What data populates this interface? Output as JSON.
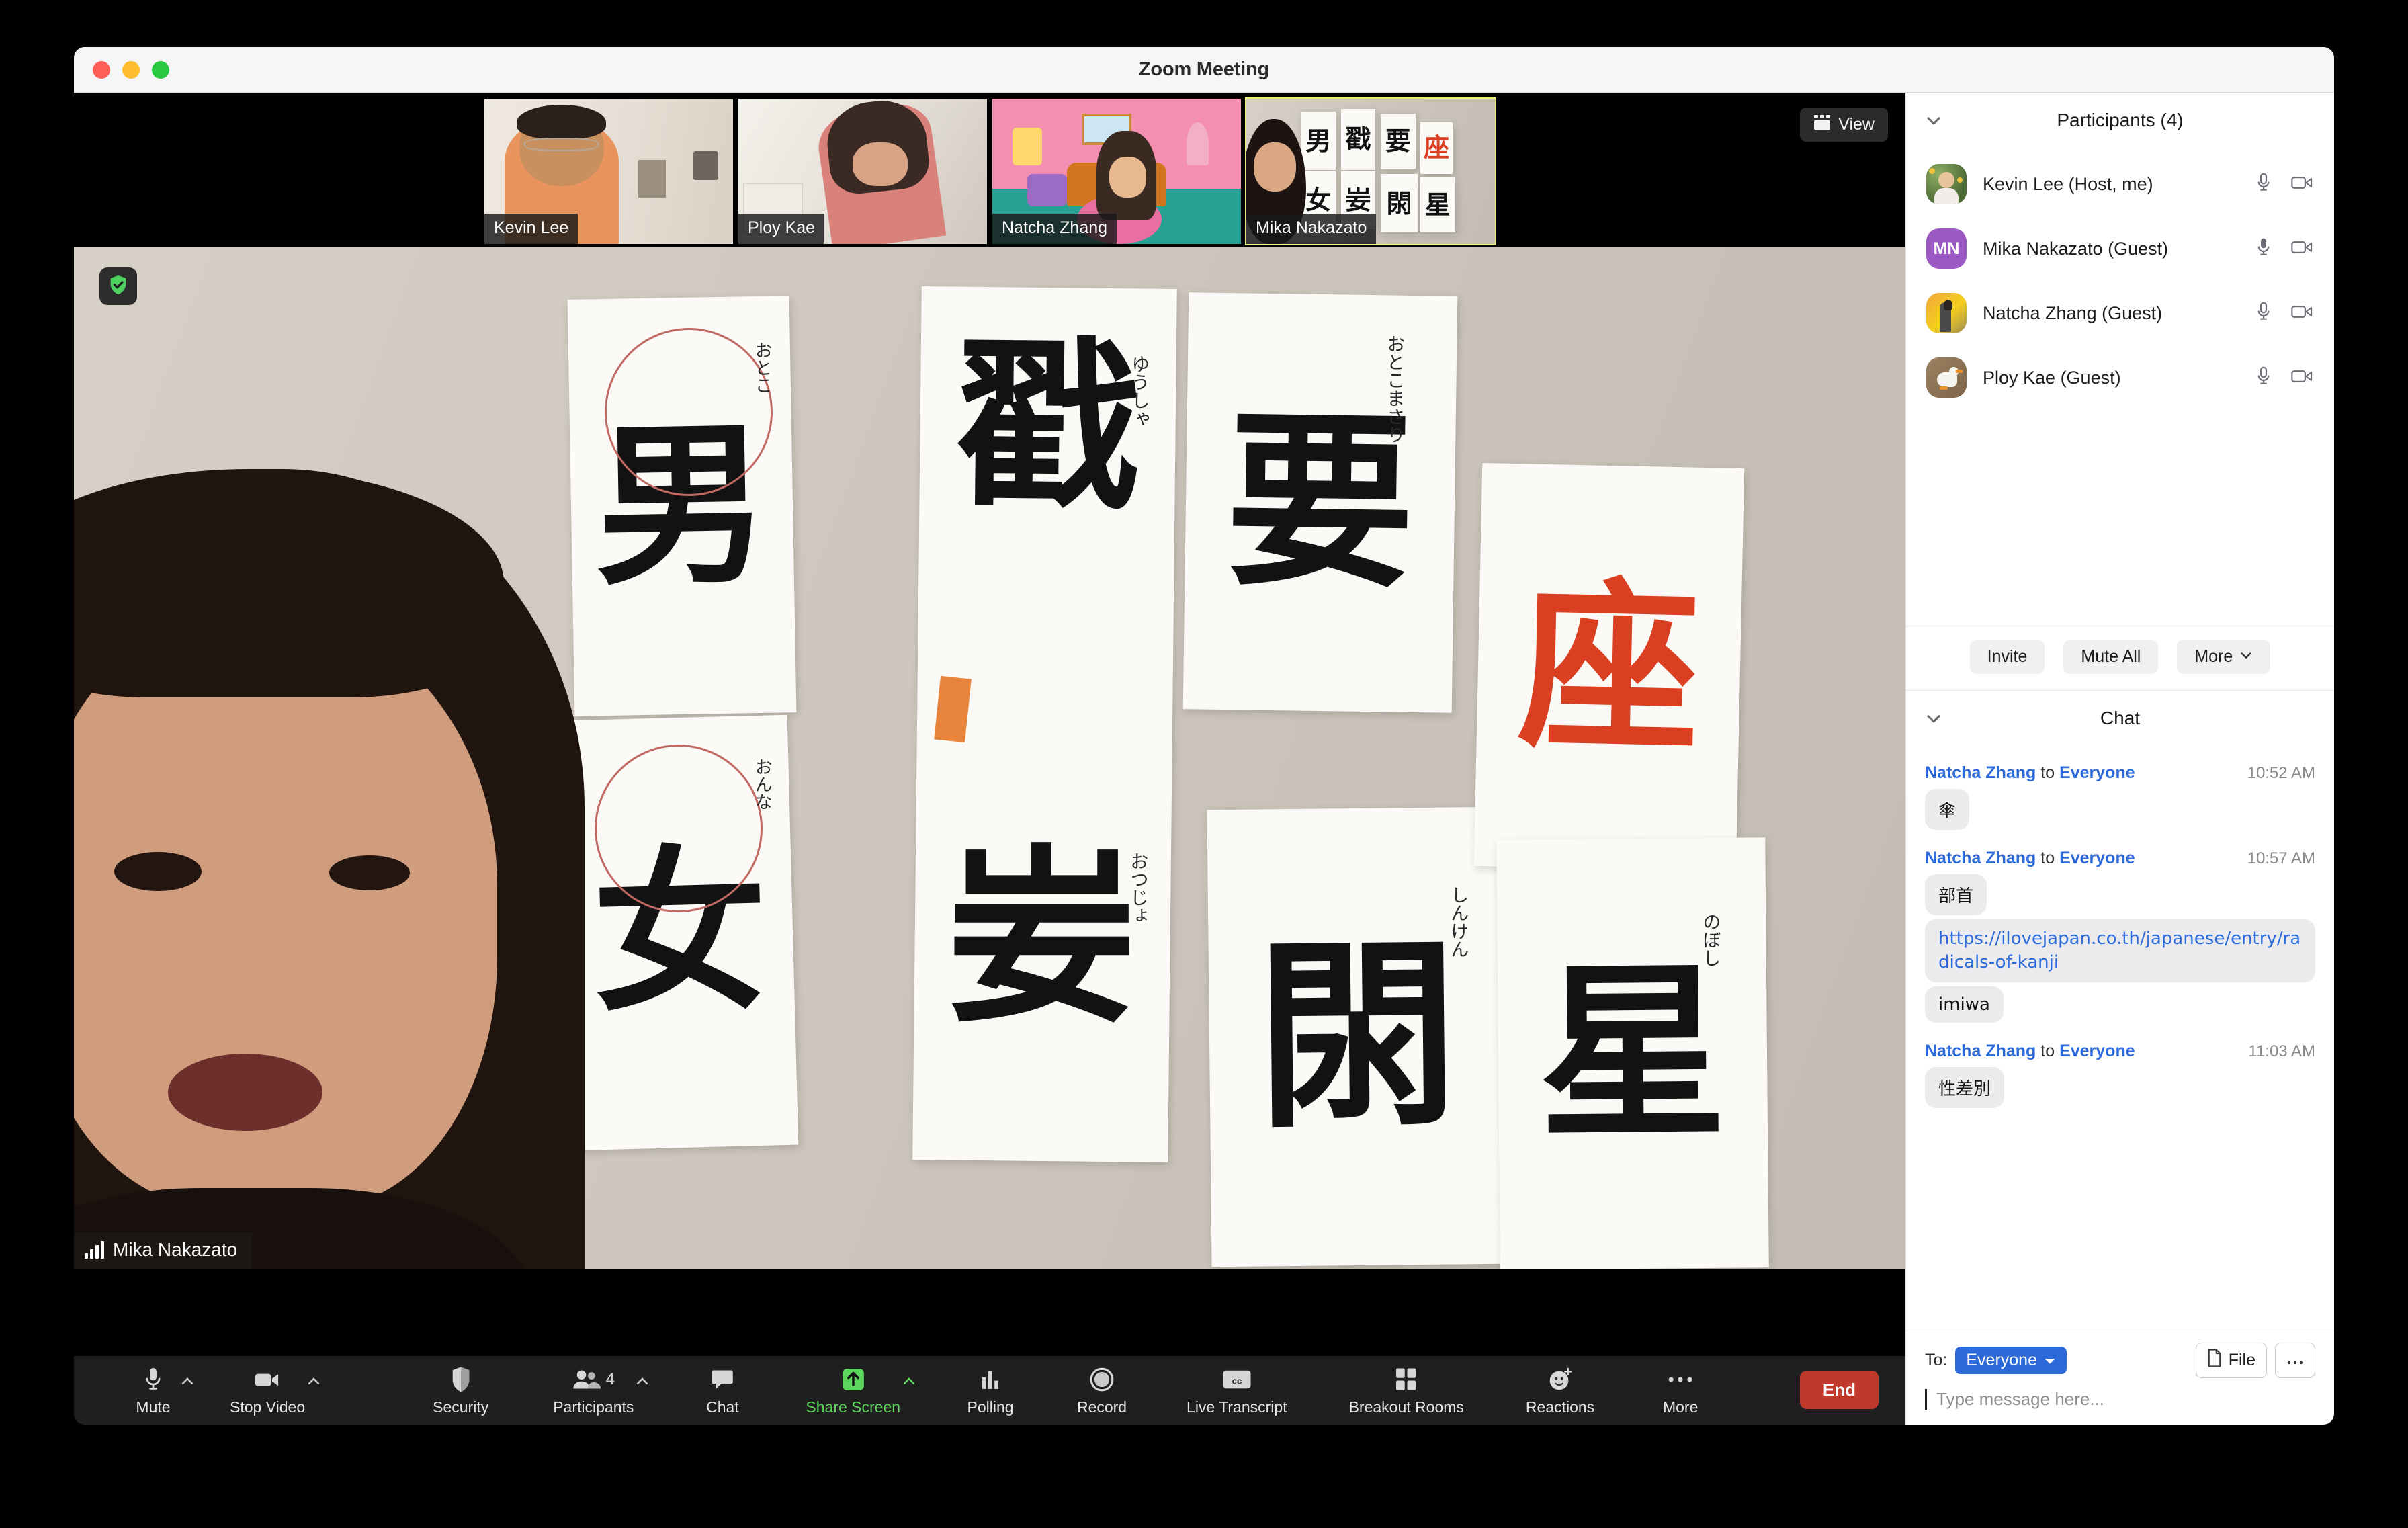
{
  "window": {
    "title": "Zoom Meeting",
    "traffic_lights": [
      "close-red",
      "minimize-yellow",
      "maximize-green"
    ]
  },
  "meeting": {
    "view_button_label": "View",
    "view_icon": "grid-view-icon",
    "encryption_icon": "shield-check-icon",
    "active_speaker": {
      "name": "Mika Nakazato",
      "audio_icon": "audio-level-bars-icon"
    },
    "thumbnails": [
      {
        "name": "Kevin Lee",
        "active": false,
        "scene": "man-glasses-room"
      },
      {
        "name": "Ploy Kae",
        "active": false,
        "scene": "woman-bright-window"
      },
      {
        "name": "Natcha Zhang",
        "active": false,
        "scene": "woman-pink-cartoon-bg"
      },
      {
        "name": "Mika Nakazato",
        "active": true,
        "scene": "woman-calligraphy-wall"
      }
    ],
    "calligraphy": {
      "sheets": [
        {
          "kanji": "男",
          "furigana": "おとこ",
          "circled": true,
          "red": false
        },
        {
          "kanji": "女",
          "furigana": "おんな",
          "circled": true,
          "red": false
        },
        {
          "kanji": "戳",
          "furigana": "ゆうしゃ",
          "circled": false,
          "red": false
        },
        {
          "kanji": "妛",
          "furigana": "おつじょ",
          "circled": false,
          "red": false
        },
        {
          "kanji": "要",
          "furigana": "おとこまさり",
          "circled": false,
          "red": false
        },
        {
          "kanji": "閖",
          "furigana": "しんけん",
          "circled": false,
          "red": false
        },
        {
          "kanji": "座",
          "furigana": "",
          "circled": false,
          "red": true
        },
        {
          "kanji": "星",
          "furigana": "のぼし",
          "circled": false,
          "red": false
        }
      ]
    }
  },
  "toolbar": {
    "items": [
      {
        "label": "Mute",
        "icon": "microphone-icon",
        "caret": true,
        "badge": "",
        "accent": ""
      },
      {
        "label": "Stop Video",
        "icon": "video-camera-icon",
        "caret": true,
        "badge": "",
        "accent": ""
      },
      {
        "label": "Security",
        "icon": "shield-icon",
        "caret": false,
        "badge": "",
        "accent": ""
      },
      {
        "label": "Participants",
        "icon": "people-icon",
        "caret": true,
        "badge": "4",
        "accent": ""
      },
      {
        "label": "Chat",
        "icon": "chat-bubble-icon",
        "caret": false,
        "badge": "",
        "accent": ""
      },
      {
        "label": "Share Screen",
        "icon": "share-screen-icon",
        "caret": true,
        "badge": "",
        "accent": "#5cd65c"
      },
      {
        "label": "Polling",
        "icon": "poll-bars-icon",
        "caret": false,
        "badge": "",
        "accent": ""
      },
      {
        "label": "Record",
        "icon": "record-circle-icon",
        "caret": false,
        "badge": "",
        "accent": ""
      },
      {
        "label": "Live Transcript",
        "icon": "closed-caption-icon",
        "caret": false,
        "badge": "",
        "accent": ""
      },
      {
        "label": "Breakout Rooms",
        "icon": "breakout-grid-icon",
        "caret": false,
        "badge": "",
        "accent": ""
      },
      {
        "label": "Reactions",
        "icon": "smiley-plus-icon",
        "caret": false,
        "badge": "",
        "accent": ""
      },
      {
        "label": "More",
        "icon": "ellipsis-icon",
        "caret": false,
        "badge": "",
        "accent": ""
      }
    ],
    "end_label": "End",
    "end_color": "#c0392b"
  },
  "sidebar": {
    "participants_panel": {
      "title": "Participants (4)",
      "collapse_icon": "chevron-down-icon",
      "rows": [
        {
          "name": "Kevin Lee (Host, me)",
          "avatar_type": "photo",
          "avatar_text": "",
          "avatar_color": "#6f8f5a",
          "mic_icon": "microphone-icon",
          "mic_muted": false,
          "video_icon": "video-camera-icon"
        },
        {
          "name": "Mika Nakazato (Guest)",
          "avatar_type": "initials",
          "avatar_text": "MN",
          "avatar_color": "#9b59c4",
          "mic_icon": "microphone-icon",
          "mic_muted": true,
          "video_icon": "video-camera-icon"
        },
        {
          "name": "Natcha Zhang (Guest)",
          "avatar_type": "photo",
          "avatar_text": "",
          "avatar_color": "#f2c014",
          "mic_icon": "microphone-icon",
          "mic_muted": false,
          "video_icon": "video-camera-icon"
        },
        {
          "name": "Ploy Kae (Guest)",
          "avatar_type": "photo",
          "avatar_text": "",
          "avatar_color": "#8a7254",
          "mic_icon": "microphone-icon",
          "mic_muted": false,
          "video_icon": "video-camera-icon"
        }
      ],
      "actions": [
        {
          "label": "Invite",
          "caret": false
        },
        {
          "label": "Mute All",
          "caret": false
        },
        {
          "label": "More",
          "caret": true
        }
      ]
    },
    "chat_panel": {
      "title": "Chat",
      "collapse_icon": "chevron-down-icon",
      "messages": [
        {
          "sender": "Natcha Zhang",
          "to_word": "to",
          "recipient": "Everyone",
          "time": "10:52 AM",
          "bubbles": [
            {
              "text": "傘",
              "is_link": false
            }
          ]
        },
        {
          "sender": "Natcha Zhang",
          "to_word": "to",
          "recipient": "Everyone",
          "time": "10:57 AM",
          "bubbles": [
            {
              "text": "部首",
              "is_link": false
            },
            {
              "text": "https://ilovejapan.co.th/japanese/entry/radicals-of-kanji",
              "is_link": true
            },
            {
              "text": "imiwa",
              "is_link": false
            }
          ]
        },
        {
          "sender": "Natcha Zhang",
          "to_word": "to",
          "recipient": "Everyone",
          "time": "11:03 AM",
          "bubbles": [
            {
              "text": "性差別",
              "is_link": false
            }
          ]
        }
      ],
      "compose": {
        "to_label": "To:",
        "recipient": "Everyone",
        "recipient_caret_icon": "caret-down-icon",
        "file_label": "File",
        "file_icon": "document-icon",
        "more_icon": "ellipsis-icon",
        "placeholder": "Type message here..."
      }
    }
  }
}
